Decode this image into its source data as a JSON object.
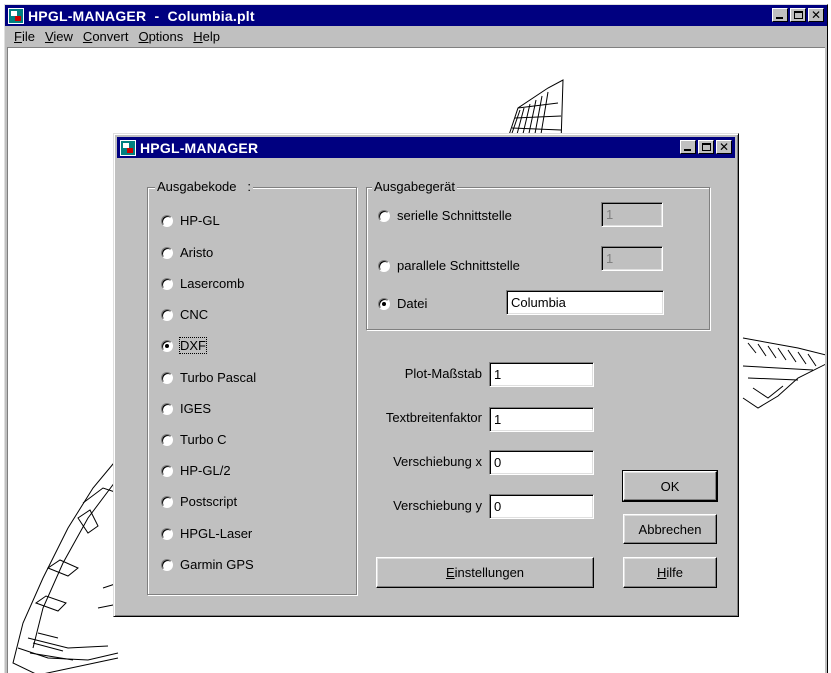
{
  "main_window": {
    "title": "HPGL-MANAGER  -  Columbia.plt",
    "menu": [
      {
        "mnemonic": "F",
        "rest": "ile"
      },
      {
        "mnemonic": "V",
        "rest": "iew"
      },
      {
        "mnemonic": "C",
        "rest": "onvert"
      },
      {
        "mnemonic": "O",
        "rest": "ptions"
      },
      {
        "mnemonic": "H",
        "rest": "elp"
      }
    ]
  },
  "dialog": {
    "title": "HPGL-MANAGER",
    "output_code": {
      "legend": "Ausgabekode   :",
      "options": [
        "HP-GL",
        "Aristo",
        "Lasercomb",
        "CNC",
        "DXF",
        "Turbo Pascal",
        "IGES",
        "Turbo C",
        "HP-GL/2",
        "Postscript",
        "HPGL-Laser",
        "Garmin GPS"
      ],
      "selected": "DXF"
    },
    "output_device": {
      "legend": "Ausgabegerät",
      "serial_label": "serielle Schnittstelle",
      "serial_value": "1",
      "parallel_label": "parallele Schnittstelle",
      "parallel_value": "1",
      "file_label": "Datei",
      "file_value": "Columbia",
      "selected": "Datei"
    },
    "fields": {
      "plot_scale_label": "Plot-Maßstab",
      "plot_scale_value": "1",
      "text_width_label": "Textbreitenfaktor",
      "text_width_value": "1",
      "offset_x_label": "Verschiebung x",
      "offset_x_value": "0",
      "offset_y_label": "Verschiebung y",
      "offset_y_value": "0"
    },
    "buttons": {
      "ok": "OK",
      "cancel": "Abbrechen",
      "settings_mnemonic": "E",
      "settings_rest": "instellungen",
      "help_mnemonic": "H",
      "help_rest": "ilfe"
    }
  }
}
